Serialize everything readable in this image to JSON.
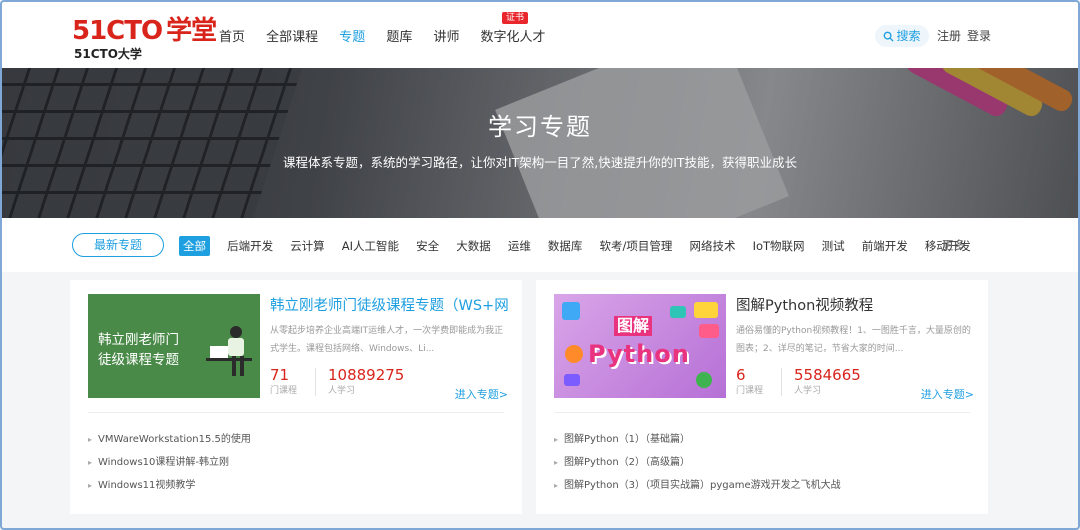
{
  "header": {
    "logo_main": "51CTO",
    "logo_xt": "学堂",
    "logo_sub": "51CTO大学",
    "nav": [
      "首页",
      "全部课程",
      "专题",
      "题库",
      "讲师",
      "数字化人才"
    ],
    "badge": "证书",
    "search": "搜索",
    "register": "注册",
    "login": "登录"
  },
  "banner": {
    "title": "学习专题",
    "subtitle": "课程体系专题，系统的学习路径，让你对IT架构一目了然,快速提升你的IT技能，获得职业成长"
  },
  "filter": {
    "newest": "最新专题",
    "categories": [
      "全部",
      "后端开发",
      "云计算",
      "AI人工智能",
      "安全",
      "大数据",
      "运维",
      "数据库",
      "软考/项目管理",
      "网络技术",
      "IoT物联网",
      "测试",
      "前端开发",
      "移动开发"
    ],
    "more": "更多"
  },
  "cards": [
    {
      "thumb_text_1": "韩立刚老师门",
      "thumb_text_2": "徒级课程专题",
      "title": "韩立刚老师门徒级课程专题（WS+网...",
      "desc": "从零起步培养企业高端IT运维人才，一次学费即能成为我正式学生。课程包括网络、Windows、Li...",
      "courses": "71",
      "courses_label": "门课程",
      "learners": "10889275",
      "learners_label": "人学习",
      "enter": "进入专题>",
      "lessons": [
        "VMWareWorkstation15.5的使用",
        "Windows10课程讲解-韩立刚",
        "Windows11视频教学"
      ]
    },
    {
      "thumb_tu": "图解",
      "thumb_py": "Python",
      "title": "图解Python视频教程",
      "desc": "通俗易懂的Python视频教程！1、一图胜千言，大量原创的图表；2、详尽的笔记，节省大家的时间...",
      "courses": "6",
      "courses_label": "门课程",
      "learners": "5584665",
      "learners_label": "人学习",
      "enter": "进入专题>",
      "lessons": [
        "图解Python（1）（基础篇）",
        "图解Python（2）（高级篇）",
        "图解Python（3）（项目实战篇）pygame游戏开发之飞机大战"
      ]
    }
  ]
}
